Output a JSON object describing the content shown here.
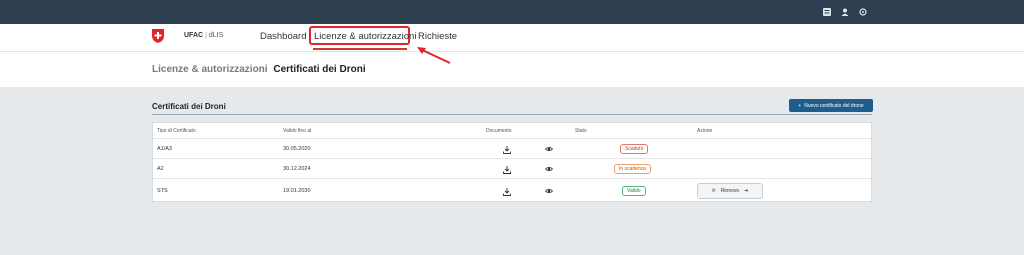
{
  "topbar": {
    "icons": [
      "grid-icon",
      "user-icon",
      "settings-icon"
    ]
  },
  "brand": {
    "org": "UFAC",
    "separator": "|",
    "app": "dLIS"
  },
  "nav": {
    "items": [
      {
        "label": "Dashboard"
      },
      {
        "label": "Licenze & autorizzazioni"
      },
      {
        "label": "Richieste"
      }
    ],
    "active_index": 1
  },
  "breadcrumb": {
    "parent": "Licenze & autorizzazioni",
    "current": "Certificati dei Droni"
  },
  "section": {
    "title": "Certificati dei Droni",
    "new_button_label": "Nuovo certificato del drone"
  },
  "table": {
    "headers": [
      "Tipo di Certificato",
      "Valido fino al",
      "Documento",
      "Stato",
      "Azione"
    ],
    "rows": [
      {
        "type": "A1/A3",
        "valid_until": "30.05.2020",
        "status": "Scaduto",
        "status_kind": "expired",
        "action": ""
      },
      {
        "type": "A2",
        "valid_until": "30.12.2024",
        "status": "In scadenza",
        "status_kind": "expiring",
        "action": ""
      },
      {
        "type": "STS",
        "valid_until": "19.01.2030",
        "status": "Valido",
        "status_kind": "valid",
        "action": "Rinnovo"
      }
    ]
  },
  "colors": {
    "topbar": "#2c3e50",
    "accent": "#1f5e8c",
    "highlight": "#e2232a"
  }
}
